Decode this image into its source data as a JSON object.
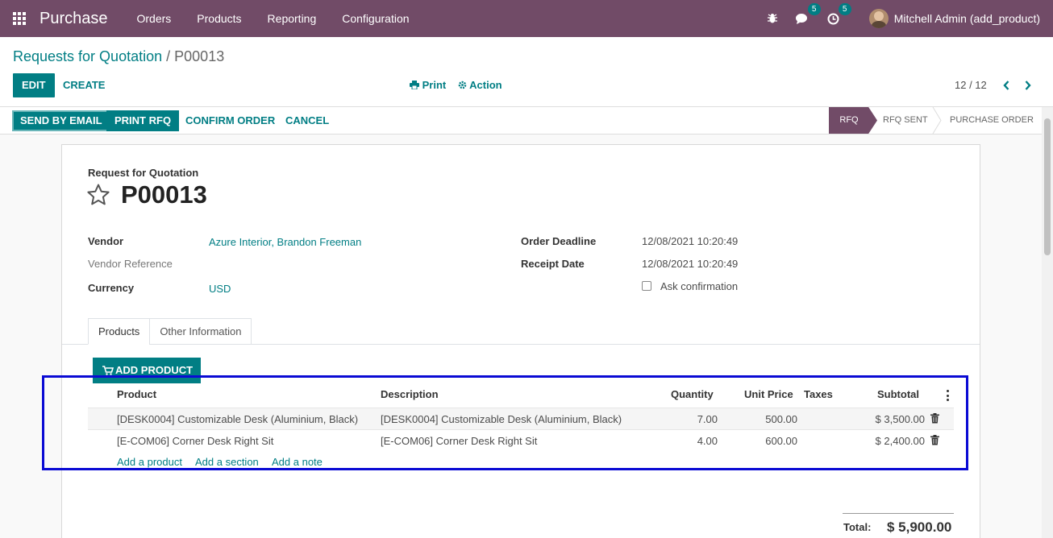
{
  "navbar": {
    "app_name": "Purchase",
    "menu": [
      "Orders",
      "Products",
      "Reporting",
      "Configuration"
    ],
    "messages_count": "5",
    "activities_count": "5",
    "user_name": "Mitchell Admin (add_product)"
  },
  "breadcrumb": {
    "parent": "Requests for Quotation",
    "separator": "/",
    "current": "P00013"
  },
  "control": {
    "edit": "EDIT",
    "create": "CREATE",
    "print": "Print",
    "action": "Action",
    "pager": "12 / 12"
  },
  "statusbar": {
    "send_by_email": "SEND BY EMAIL",
    "print_rfq": "PRINT RFQ",
    "confirm_order": "CONFIRM ORDER",
    "cancel": "CANCEL",
    "stages": [
      "RFQ",
      "RFQ SENT",
      "PURCHASE ORDER"
    ],
    "active_stage": "RFQ"
  },
  "form": {
    "doc_type": "Request for Quotation",
    "doc_name": "P00013",
    "vendor_label": "Vendor",
    "vendor_value": "Azure Interior, Brandon Freeman",
    "vendor_ref_label": "Vendor Reference",
    "currency_label": "Currency",
    "currency_value": "USD",
    "order_deadline_label": "Order Deadline",
    "order_deadline_value": "12/08/2021 10:20:49",
    "receipt_date_label": "Receipt Date",
    "receipt_date_value": "12/08/2021 10:20:49",
    "ask_confirmation_label": "Ask confirmation"
  },
  "tabs": [
    "Products",
    "Other Information"
  ],
  "lines": {
    "add_product_button": "ADD PRODUCT",
    "headers": {
      "product": "Product",
      "description": "Description",
      "quantity": "Quantity",
      "unit_price": "Unit Price",
      "taxes": "Taxes",
      "subtotal": "Subtotal"
    },
    "rows": [
      {
        "product": "[DESK0004] Customizable Desk (Aluminium, Black)",
        "description": "[DESK0004] Customizable Desk (Aluminium, Black)",
        "quantity": "7.00",
        "unit_price": "500.00",
        "taxes": "",
        "subtotal": "$ 3,500.00"
      },
      {
        "product": "[E-COM06] Corner Desk Right Sit",
        "description": "[E-COM06] Corner Desk Right Sit",
        "quantity": "4.00",
        "unit_price": "600.00",
        "taxes": "",
        "subtotal": "$ 2,400.00"
      }
    ],
    "add_links": [
      "Add a product",
      "Add a section",
      "Add a note"
    ]
  },
  "totals": {
    "total_label": "Total:",
    "total_value": "$ 5,900.00"
  },
  "colors": {
    "brand": "#714b67",
    "accent": "#017e84",
    "highlight": "#0a0ad4"
  }
}
